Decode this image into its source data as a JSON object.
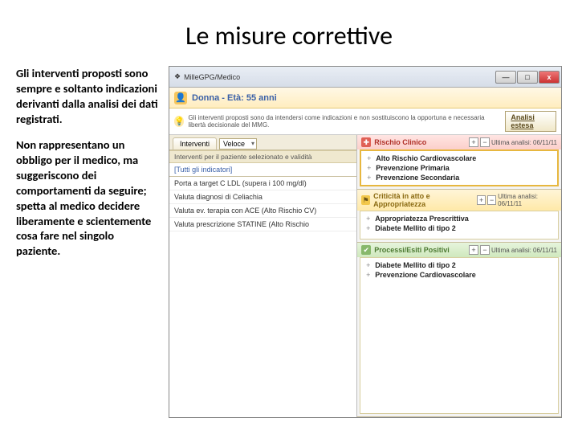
{
  "title": "Le misure correttive",
  "para1": "Gli interventi proposti sono sempre e soltanto indicazioni derivanti dalla analisi dei dati registrati.",
  "para2": "Non rappresentano un obbligo per il medico, ma suggeriscono dei comportamenti da seguire; spetta al medico decidere liberamente e scientemente cosa fare nel singolo paziente.",
  "window": {
    "title": "MilleGPG/Medico",
    "min": "—",
    "max": "□",
    "close": "x"
  },
  "patient": {
    "name": "Donna - Età: 55 anni"
  },
  "infobar": {
    "text": "Gli interventi proposti sono da intendersi come indicazioni e non sostituiscono la opportuna e necessaria libertà decisionale del MMG.",
    "button": "Analisi estesa"
  },
  "left": {
    "tab": "Interventi",
    "combo": "Veloce",
    "section": "Interventi per il paziente selezionato e validità",
    "rows": {
      "r0": "[Tutti gli indicatori]",
      "r1": "Porta a target C LDL (supera i 100 mg/dl)",
      "r2": "Valuta diagnosi di Celiachia",
      "r3": "Valuta ev. terapia con ACE (Alto Rischio CV)",
      "r4": "Valuta prescrizione STATINE (Alto Rischio"
    }
  },
  "right": {
    "date": "Ultima analisi: 06/11/11",
    "p1": {
      "title": "Rischio Clinico",
      "items": {
        "a": "Alto Rischio Cardiovascolare",
        "b": "Prevenzione Primaria",
        "c": "Prevenzione Secondaria"
      }
    },
    "p2": {
      "title": "Criticità in atto e Appropriatezza",
      "items": {
        "a": "Appropriatezza Prescrittiva",
        "b": "Diabete Mellito di tipo 2"
      }
    },
    "p3": {
      "title": "Processi/Esiti Positivi",
      "items": {
        "a": "Diabete Mellito di tipo 2",
        "b": "Prevenzione Cardiovascolare"
      }
    }
  }
}
